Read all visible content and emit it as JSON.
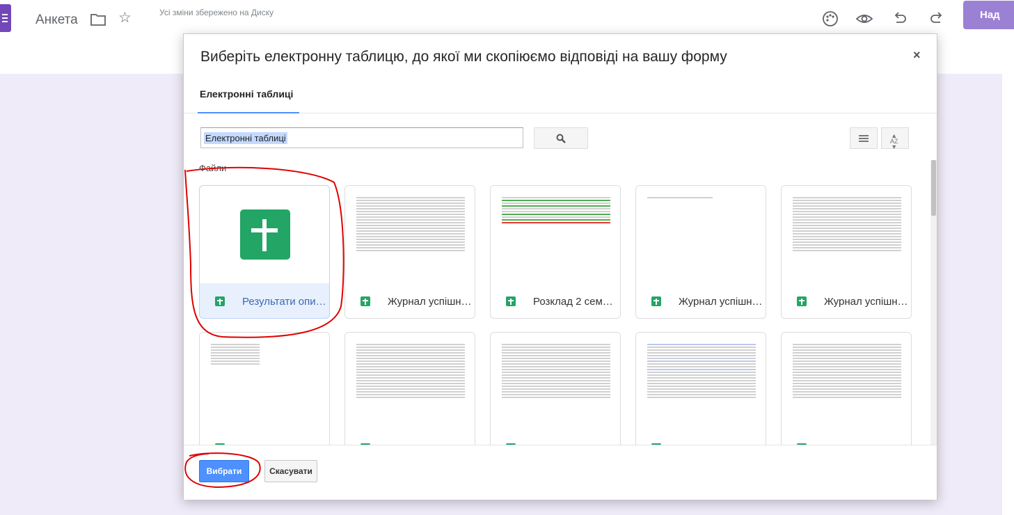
{
  "topbar": {
    "doc_title": "Анкета",
    "saved_status": "Усі зміни збережено на Диску",
    "send_button": "Над",
    "icons": [
      "folder-icon",
      "star-icon",
      "palette-icon",
      "eye-icon",
      "undo-icon",
      "redo-icon"
    ]
  },
  "dialog": {
    "title": "Виберіть електронну таблицю, до якої ми скопіюємо відповіді на вашу форму",
    "close": "×",
    "tab_label": "Електронні таблиці",
    "search_value": "Електронні таблиці",
    "files_label": "Файли",
    "select_button": "Вибрати",
    "cancel_button": "Скасувати",
    "files": [
      {
        "name": "Результати опи…",
        "selected": true
      },
      {
        "name": "Журнал успішн…"
      },
      {
        "name": "Розклад 2 сем…"
      },
      {
        "name": "Журнал успішн…"
      },
      {
        "name": "Журнал успішн…"
      },
      {
        "name": ""
      },
      {
        "name": ""
      },
      {
        "name": ""
      },
      {
        "name": ""
      },
      {
        "name": ""
      }
    ]
  },
  "colors": {
    "accent_blue": "#4d90fe",
    "forms_purple": "#7248b9",
    "sheets_green": "#23a566",
    "annotation_red": "#e00000"
  }
}
